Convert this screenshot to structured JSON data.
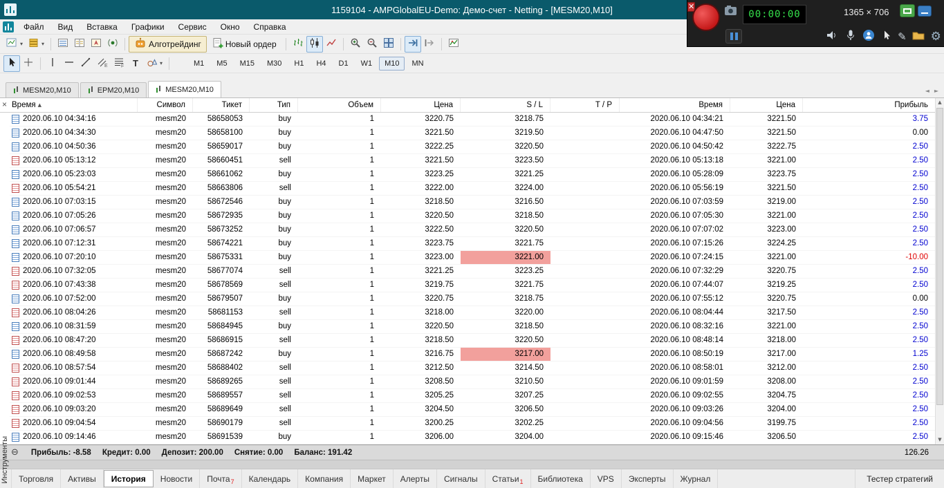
{
  "title_bar": {
    "title": "1159104 - AMPGlobalEU-Demo: Демо-счет - Netting - [MESM20,M10]"
  },
  "recorder": {
    "timer": "00:00:00",
    "size_label": "1365 × 706"
  },
  "menu": {
    "items": [
      "Файл",
      "Вид",
      "Вставка",
      "Графики",
      "Сервис",
      "Окно",
      "Справка"
    ]
  },
  "toolbar": {
    "algo_trading_label": "Алготрейдинг",
    "new_order_label": "Новый ордер",
    "timeframes": [
      "M1",
      "M5",
      "M15",
      "M30",
      "H1",
      "H4",
      "D1",
      "W1",
      "M10",
      "MN"
    ],
    "active_timeframe": "M10"
  },
  "glyphs": {
    "dropdown": "▾",
    "sort_asc": "▲",
    "close": "×",
    "collapse": "⊖",
    "tab_left": "◄",
    "tab_right": "►",
    "up": "▲",
    "down": "▼",
    "pencil": "✎",
    "gear": "⚙",
    "text_tool": "T"
  },
  "chart_tabs": [
    {
      "label": "MESM20,M10",
      "active": false
    },
    {
      "label": "EPM20,M10",
      "active": false
    },
    {
      "label": "MESM20,M10",
      "active": true
    }
  ],
  "history": {
    "columns": [
      "Время",
      "Символ",
      "Тикет",
      "Тип",
      "Объем",
      "Цена",
      "S / L",
      "T / P",
      "Время",
      "Цена",
      "Прибыль"
    ],
    "sort_column": "Время",
    "rows": [
      {
        "time": "2020.06.10 04:34:16",
        "symbol": "mesm20",
        "ticket": "58658053",
        "type": "buy",
        "volume": "1",
        "price": "3220.75",
        "sl": "3218.75",
        "sl_hl": false,
        "tp": "",
        "time2": "2020.06.10 04:34:21",
        "price2": "3221.50",
        "profit": "3.75",
        "profit_color": "blue"
      },
      {
        "time": "2020.06.10 04:34:30",
        "symbol": "mesm20",
        "ticket": "58658100",
        "type": "buy",
        "volume": "1",
        "price": "3221.50",
        "sl": "3219.50",
        "sl_hl": false,
        "tp": "",
        "time2": "2020.06.10 04:47:50",
        "price2": "3221.50",
        "profit": "0.00",
        "profit_color": "black"
      },
      {
        "time": "2020.06.10 04:50:36",
        "symbol": "mesm20",
        "ticket": "58659017",
        "type": "buy",
        "volume": "1",
        "price": "3222.25",
        "sl": "3220.50",
        "sl_hl": false,
        "tp": "",
        "time2": "2020.06.10 04:50:42",
        "price2": "3222.75",
        "profit": "2.50",
        "profit_color": "blue"
      },
      {
        "time": "2020.06.10 05:13:12",
        "symbol": "mesm20",
        "ticket": "58660451",
        "type": "sell",
        "volume": "1",
        "price": "3221.50",
        "sl": "3223.50",
        "sl_hl": false,
        "tp": "",
        "time2": "2020.06.10 05:13:18",
        "price2": "3221.00",
        "profit": "2.50",
        "profit_color": "blue"
      },
      {
        "time": "2020.06.10 05:23:03",
        "symbol": "mesm20",
        "ticket": "58661062",
        "type": "buy",
        "volume": "1",
        "price": "3223.25",
        "sl": "3221.25",
        "sl_hl": false,
        "tp": "",
        "time2": "2020.06.10 05:28:09",
        "price2": "3223.75",
        "profit": "2.50",
        "profit_color": "blue"
      },
      {
        "time": "2020.06.10 05:54:21",
        "symbol": "mesm20",
        "ticket": "58663806",
        "type": "sell",
        "volume": "1",
        "price": "3222.00",
        "sl": "3224.00",
        "sl_hl": false,
        "tp": "",
        "time2": "2020.06.10 05:56:19",
        "price2": "3221.50",
        "profit": "2.50",
        "profit_color": "blue"
      },
      {
        "time": "2020.06.10 07:03:15",
        "symbol": "mesm20",
        "ticket": "58672546",
        "type": "buy",
        "volume": "1",
        "price": "3218.50",
        "sl": "3216.50",
        "sl_hl": false,
        "tp": "",
        "time2": "2020.06.10 07:03:59",
        "price2": "3219.00",
        "profit": "2.50",
        "profit_color": "blue"
      },
      {
        "time": "2020.06.10 07:05:26",
        "symbol": "mesm20",
        "ticket": "58672935",
        "type": "buy",
        "volume": "1",
        "price": "3220.50",
        "sl": "3218.50",
        "sl_hl": false,
        "tp": "",
        "time2": "2020.06.10 07:05:30",
        "price2": "3221.00",
        "profit": "2.50",
        "profit_color": "blue"
      },
      {
        "time": "2020.06.10 07:06:57",
        "symbol": "mesm20",
        "ticket": "58673252",
        "type": "buy",
        "volume": "1",
        "price": "3222.50",
        "sl": "3220.50",
        "sl_hl": false,
        "tp": "",
        "time2": "2020.06.10 07:07:02",
        "price2": "3223.00",
        "profit": "2.50",
        "profit_color": "blue"
      },
      {
        "time": "2020.06.10 07:12:31",
        "symbol": "mesm20",
        "ticket": "58674221",
        "type": "buy",
        "volume": "1",
        "price": "3223.75",
        "sl": "3221.75",
        "sl_hl": false,
        "tp": "",
        "time2": "2020.06.10 07:15:26",
        "price2": "3224.25",
        "profit": "2.50",
        "profit_color": "blue"
      },
      {
        "time": "2020.06.10 07:20:10",
        "symbol": "mesm20",
        "ticket": "58675331",
        "type": "buy",
        "volume": "1",
        "price": "3223.00",
        "sl": "3221.00",
        "sl_hl": true,
        "tp": "",
        "time2": "2020.06.10 07:24:15",
        "price2": "3221.00",
        "profit": "-10.00",
        "profit_color": "red"
      },
      {
        "time": "2020.06.10 07:32:05",
        "symbol": "mesm20",
        "ticket": "58677074",
        "type": "sell",
        "volume": "1",
        "price": "3221.25",
        "sl": "3223.25",
        "sl_hl": false,
        "tp": "",
        "time2": "2020.06.10 07:32:29",
        "price2": "3220.75",
        "profit": "2.50",
        "profit_color": "blue"
      },
      {
        "time": "2020.06.10 07:43:38",
        "symbol": "mesm20",
        "ticket": "58678569",
        "type": "sell",
        "volume": "1",
        "price": "3219.75",
        "sl": "3221.75",
        "sl_hl": false,
        "tp": "",
        "time2": "2020.06.10 07:44:07",
        "price2": "3219.25",
        "profit": "2.50",
        "profit_color": "blue"
      },
      {
        "time": "2020.06.10 07:52:00",
        "symbol": "mesm20",
        "ticket": "58679507",
        "type": "buy",
        "volume": "1",
        "price": "3220.75",
        "sl": "3218.75",
        "sl_hl": false,
        "tp": "",
        "time2": "2020.06.10 07:55:12",
        "price2": "3220.75",
        "profit": "0.00",
        "profit_color": "black"
      },
      {
        "time": "2020.06.10 08:04:26",
        "symbol": "mesm20",
        "ticket": "58681153",
        "type": "sell",
        "volume": "1",
        "price": "3218.00",
        "sl": "3220.00",
        "sl_hl": false,
        "tp": "",
        "time2": "2020.06.10 08:04:44",
        "price2": "3217.50",
        "profit": "2.50",
        "profit_color": "blue"
      },
      {
        "time": "2020.06.10 08:31:59",
        "symbol": "mesm20",
        "ticket": "58684945",
        "type": "buy",
        "volume": "1",
        "price": "3220.50",
        "sl": "3218.50",
        "sl_hl": false,
        "tp": "",
        "time2": "2020.06.10 08:32:16",
        "price2": "3221.00",
        "profit": "2.50",
        "profit_color": "blue"
      },
      {
        "time": "2020.06.10 08:47:20",
        "symbol": "mesm20",
        "ticket": "58686915",
        "type": "sell",
        "volume": "1",
        "price": "3218.50",
        "sl": "3220.50",
        "sl_hl": false,
        "tp": "",
        "time2": "2020.06.10 08:48:14",
        "price2": "3218.00",
        "profit": "2.50",
        "profit_color": "blue"
      },
      {
        "time": "2020.06.10 08:49:58",
        "symbol": "mesm20",
        "ticket": "58687242",
        "type": "buy",
        "volume": "1",
        "price": "3216.75",
        "sl": "3217.00",
        "sl_hl": true,
        "tp": "",
        "time2": "2020.06.10 08:50:19",
        "price2": "3217.00",
        "profit": "1.25",
        "profit_color": "blue"
      },
      {
        "time": "2020.06.10 08:57:54",
        "symbol": "mesm20",
        "ticket": "58688402",
        "type": "sell",
        "volume": "1",
        "price": "3212.50",
        "sl": "3214.50",
        "sl_hl": false,
        "tp": "",
        "time2": "2020.06.10 08:58:01",
        "price2": "3212.00",
        "profit": "2.50",
        "profit_color": "blue"
      },
      {
        "time": "2020.06.10 09:01:44",
        "symbol": "mesm20",
        "ticket": "58689265",
        "type": "sell",
        "volume": "1",
        "price": "3208.50",
        "sl": "3210.50",
        "sl_hl": false,
        "tp": "",
        "time2": "2020.06.10 09:01:59",
        "price2": "3208.00",
        "profit": "2.50",
        "profit_color": "blue"
      },
      {
        "time": "2020.06.10 09:02:53",
        "symbol": "mesm20",
        "ticket": "58689557",
        "type": "sell",
        "volume": "1",
        "price": "3205.25",
        "sl": "3207.25",
        "sl_hl": false,
        "tp": "",
        "time2": "2020.06.10 09:02:55",
        "price2": "3204.75",
        "profit": "2.50",
        "profit_color": "blue"
      },
      {
        "time": "2020.06.10 09:03:20",
        "symbol": "mesm20",
        "ticket": "58689649",
        "type": "sell",
        "volume": "1",
        "price": "3204.50",
        "sl": "3206.50",
        "sl_hl": false,
        "tp": "",
        "time2": "2020.06.10 09:03:26",
        "price2": "3204.00",
        "profit": "2.50",
        "profit_color": "blue"
      },
      {
        "time": "2020.06.10 09:04:54",
        "symbol": "mesm20",
        "ticket": "58690179",
        "type": "sell",
        "volume": "1",
        "price": "3200.25",
        "sl": "3202.25",
        "sl_hl": false,
        "tp": "",
        "time2": "2020.06.10 09:04:56",
        "price2": "3199.75",
        "profit": "2.50",
        "profit_color": "blue"
      },
      {
        "time": "2020.06.10 09:14:46",
        "symbol": "mesm20",
        "ticket": "58691539",
        "type": "buy",
        "volume": "1",
        "price": "3206.00",
        "sl": "3204.00",
        "sl_hl": false,
        "tp": "",
        "time2": "2020.06.10 09:15:46",
        "price2": "3206.50",
        "profit": "2.50",
        "profit_color": "blue"
      }
    ]
  },
  "summary": {
    "items": [
      {
        "label": "Прибыль:",
        "value": "-8.58"
      },
      {
        "label": "Кредит:",
        "value": "0.00"
      },
      {
        "label": "Депозит:",
        "value": "200.00"
      },
      {
        "label": "Снятие:",
        "value": "0.00"
      },
      {
        "label": "Баланс:",
        "value": "191.42"
      }
    ],
    "right_value": "126.26"
  },
  "bottom_tabs": [
    {
      "label": "Торговля",
      "active": false
    },
    {
      "label": "Активы",
      "active": false
    },
    {
      "label": "История",
      "active": true
    },
    {
      "label": "Новости",
      "active": false
    },
    {
      "label": "Почта",
      "badge": "7",
      "active": false
    },
    {
      "label": "Календарь",
      "active": false
    },
    {
      "label": "Компания",
      "active": false
    },
    {
      "label": "Маркет",
      "active": false
    },
    {
      "label": "Алерты",
      "active": false
    },
    {
      "label": "Сигналы",
      "active": false
    },
    {
      "label": "Статьи",
      "badge": "1",
      "active": false
    },
    {
      "label": "Библиотека",
      "active": false
    },
    {
      "label": "VPS",
      "active": false
    },
    {
      "label": "Эксперты",
      "active": false
    },
    {
      "label": "Журнал",
      "active": false
    }
  ],
  "tester_label": "Тестер стратегий",
  "toolbox_label": "Инструменты",
  "colors": {
    "titlebar": "#0a5a6b",
    "profit_positive": "#0000d0",
    "profit_negative": "#e00000",
    "sl_highlight": "#f2a09c"
  }
}
